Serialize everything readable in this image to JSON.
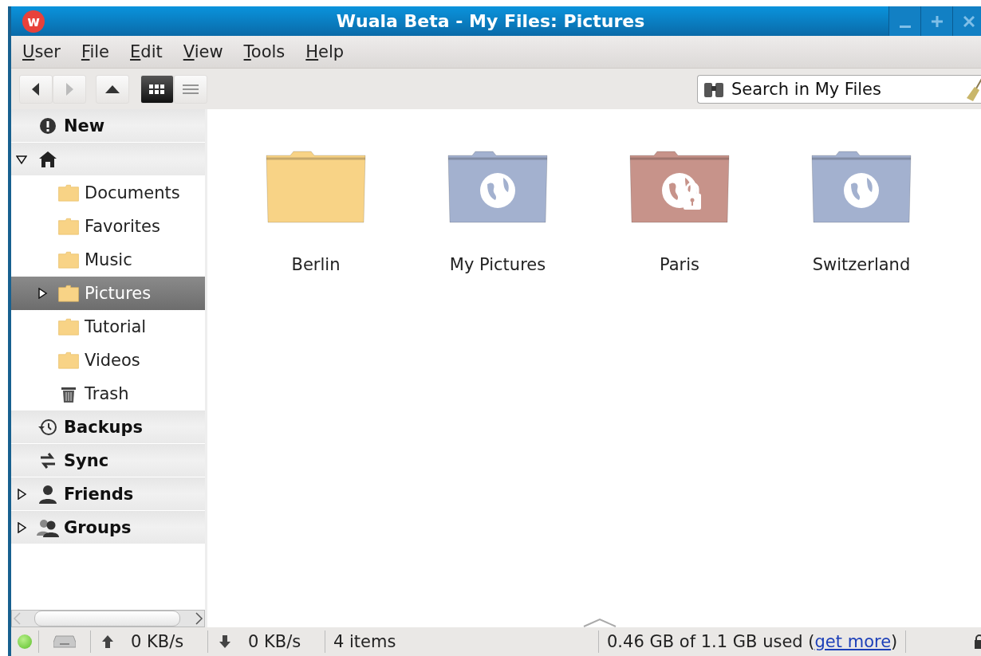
{
  "window": {
    "title": "Wuala Beta - My Files: Pictures",
    "logo": "w"
  },
  "menu": [
    {
      "label": "User"
    },
    {
      "label": "File"
    },
    {
      "label": "Edit"
    },
    {
      "label": "View"
    },
    {
      "label": "Tools"
    },
    {
      "label": "Help"
    }
  ],
  "toolbar": {
    "back_disabled": false,
    "forward_disabled": true,
    "views": [
      {
        "kind": "grid",
        "selected": true
      },
      {
        "kind": "list",
        "selected": false
      }
    ]
  },
  "search": {
    "placeholder": "Search in My Files"
  },
  "sidebar": [
    {
      "kind": "new",
      "label": "New"
    },
    {
      "kind": "home",
      "expanded": true,
      "children": [
        {
          "kind": "folder",
          "label": "Documents",
          "selected": false
        },
        {
          "kind": "folder",
          "label": "Favorites",
          "selected": false
        },
        {
          "kind": "folder",
          "label": "Music",
          "selected": false
        },
        {
          "kind": "folder",
          "label": "Pictures",
          "selected": true,
          "expanded": false
        },
        {
          "kind": "folder",
          "label": "Tutorial",
          "selected": false
        },
        {
          "kind": "folder",
          "label": "Videos",
          "selected": false
        },
        {
          "kind": "trash",
          "label": "Trash",
          "selected": false
        }
      ]
    },
    {
      "kind": "backups",
      "label": "Backups"
    },
    {
      "kind": "sync",
      "label": "Sync"
    },
    {
      "kind": "friends",
      "label": "Friends",
      "expanded": false
    },
    {
      "kind": "groups",
      "label": "Groups",
      "expanded": false
    }
  ],
  "folders": [
    {
      "name": "Berlin",
      "kind": "private",
      "color": "#f8d386"
    },
    {
      "name": "My Pictures",
      "kind": "public",
      "color": "#a3b1cf"
    },
    {
      "name": "Paris",
      "kind": "locked",
      "color": "#c7938a"
    },
    {
      "name": "Switzerland",
      "kind": "public",
      "color": "#a3b1cf"
    }
  ],
  "status_bar": {
    "online": true,
    "upload": "0 KB/s",
    "download": "0 KB/s",
    "count": "4 items",
    "usage": "0.46 GB of 1.1 GB used (",
    "usage_link": "get more",
    "usage_end": ")"
  }
}
